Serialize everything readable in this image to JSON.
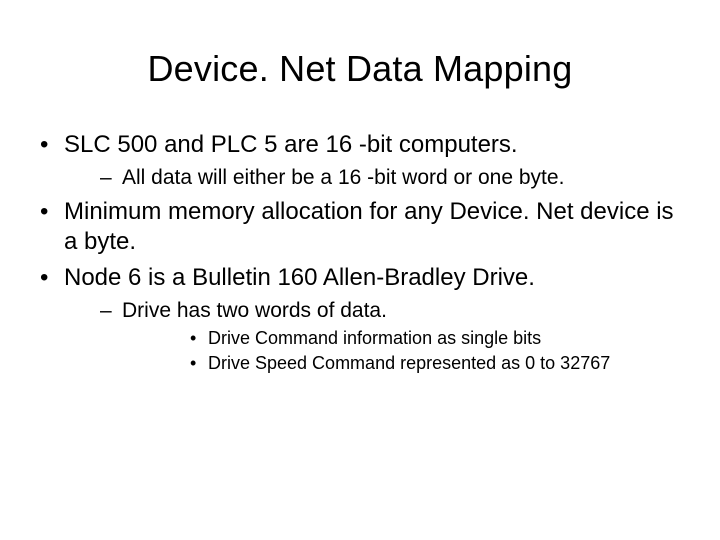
{
  "title": "Device. Net Data Mapping",
  "bullets": {
    "b1": "SLC 500 and PLC 5 are 16 -bit computers.",
    "b1_1": "All data will either be a 16 -bit word or one byte.",
    "b2": "Minimum memory allocation for any Device. Net device is a byte.",
    "b3": "Node 6 is a Bulletin 160 Allen-Bradley Drive.",
    "b3_1": "Drive has two words of data.",
    "b3_1_1": "Drive Command information as single bits",
    "b3_1_2": "Drive Speed Command represented as 0 to 32767"
  }
}
